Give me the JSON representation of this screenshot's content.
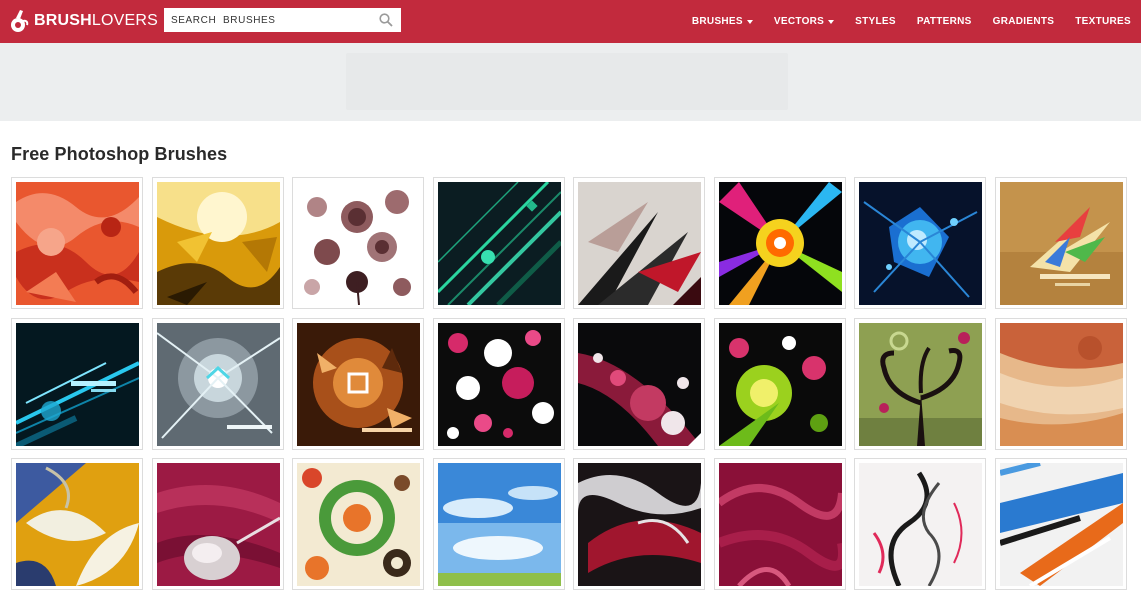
{
  "header": {
    "logo": {
      "bold": "BRUSH",
      "light": "LOVERS"
    },
    "search": {
      "placeholder": "SEARCH  BRUSHES"
    },
    "nav": [
      {
        "label": "BRUSHES",
        "dropdown": true
      },
      {
        "label": "VECTORS",
        "dropdown": true
      },
      {
        "label": "STYLES",
        "dropdown": false
      },
      {
        "label": "PATTERNS",
        "dropdown": false
      },
      {
        "label": "GRADIENTS",
        "dropdown": false
      },
      {
        "label": "TEXTURES",
        "dropdown": false
      }
    ]
  },
  "colors": {
    "brand": "#c22a3d",
    "banner": "#eceeef",
    "title": "#2a2a2a"
  },
  "main": {
    "title": "Free Photoshop Brushes",
    "rows": [
      [
        {
          "name": "red-abstract",
          "icon": "red-brush-thumbnail"
        },
        {
          "name": "golden-light",
          "icon": "gold-burst-thumbnail"
        },
        {
          "name": "roses",
          "icon": "rose-flowers-thumbnail"
        },
        {
          "name": "digital-lines",
          "icon": "green-lines-thumbnail"
        },
        {
          "name": "grunge-strokes",
          "icon": "black-strokes-thumbnail"
        },
        {
          "name": "spectrum-burst",
          "icon": "rainbow-burst-thumbnail"
        },
        {
          "name": "blue-explosion",
          "icon": "blue-explosion-thumbnail"
        },
        {
          "name": "fortune",
          "icon": "fortune-splash-thumbnail"
        }
      ],
      [
        {
          "name": "europa",
          "icon": "cyan-streaks-thumbnail"
        },
        {
          "name": "kinetic",
          "icon": "kinetic-light-thumbnail"
        },
        {
          "name": "euphoria",
          "icon": "euphoria-shards-thumbnail"
        },
        {
          "name": "pink-splatter",
          "icon": "pink-splatter-thumbnail"
        },
        {
          "name": "splatter-burst",
          "icon": "splatter-burst-thumbnail"
        },
        {
          "name": "green-splash",
          "icon": "green-splash-thumbnail"
        },
        {
          "name": "swirly-tree",
          "icon": "tree-swirls-thumbnail"
        },
        {
          "name": "watercolor",
          "icon": "watercolor-thumbnail"
        }
      ],
      [
        {
          "name": "leaves",
          "icon": "leaves-thumbnail"
        },
        {
          "name": "silk",
          "icon": "silk-thumbnail"
        },
        {
          "name": "retro-circles",
          "icon": "retro-circles-thumbnail"
        },
        {
          "name": "sky-clouds",
          "icon": "sky-clouds-thumbnail"
        },
        {
          "name": "red-smoke",
          "icon": "red-smoke-thumbnail"
        },
        {
          "name": "pink-smoke",
          "icon": "pink-smoke-thumbnail"
        },
        {
          "name": "black-smoke",
          "icon": "black-smoke-thumbnail"
        },
        {
          "name": "paint-strokes",
          "icon": "paint-strokes-thumbnail"
        }
      ]
    ]
  }
}
